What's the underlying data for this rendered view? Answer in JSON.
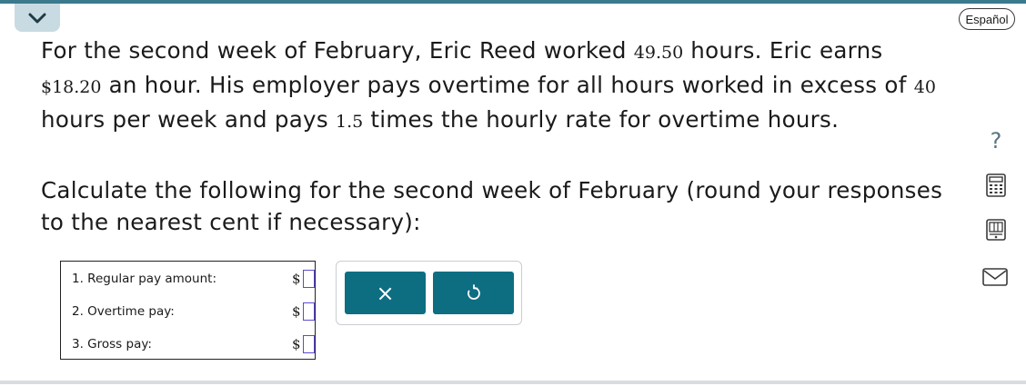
{
  "header": {
    "collapse_icon": "chevron-down-icon",
    "language_label": "Español"
  },
  "problem": {
    "p1_a": "For the second week of February, Eric Reed worked ",
    "hours_worked": "49.50",
    "p1_b": " hours. Eric earns",
    "rate": "$18.20",
    "p1_c": " an hour. His employer pays overtime for all hours worked in excess of ",
    "threshold": "40",
    "p1_d": " hours per week and pays ",
    "multiplier": "1.5",
    "p1_e": " times the hourly rate for overtime hours.",
    "p2": "Calculate the following for the second week of February (round your responses to the nearest cent if necessary):"
  },
  "answers": [
    {
      "label": "1. Regular pay amount:",
      "currency": "$",
      "value": ""
    },
    {
      "label": "2. Overtime pay:",
      "currency": "$",
      "value": ""
    },
    {
      "label": "3. Gross pay:",
      "currency": "$",
      "value": ""
    }
  ],
  "buttons": {
    "clear_symbol": "×",
    "undo_icon": "undo-icon"
  },
  "sidebar": {
    "help_symbol": "?",
    "icons": [
      "help-icon",
      "calculator-icon",
      "periodic-table-icon",
      "mail-icon"
    ]
  },
  "colors": {
    "accent": "#0d6e82",
    "top_bar": "#3b7a8c",
    "tab": "#c9dbe2",
    "input_border": "#5b4bd1"
  }
}
